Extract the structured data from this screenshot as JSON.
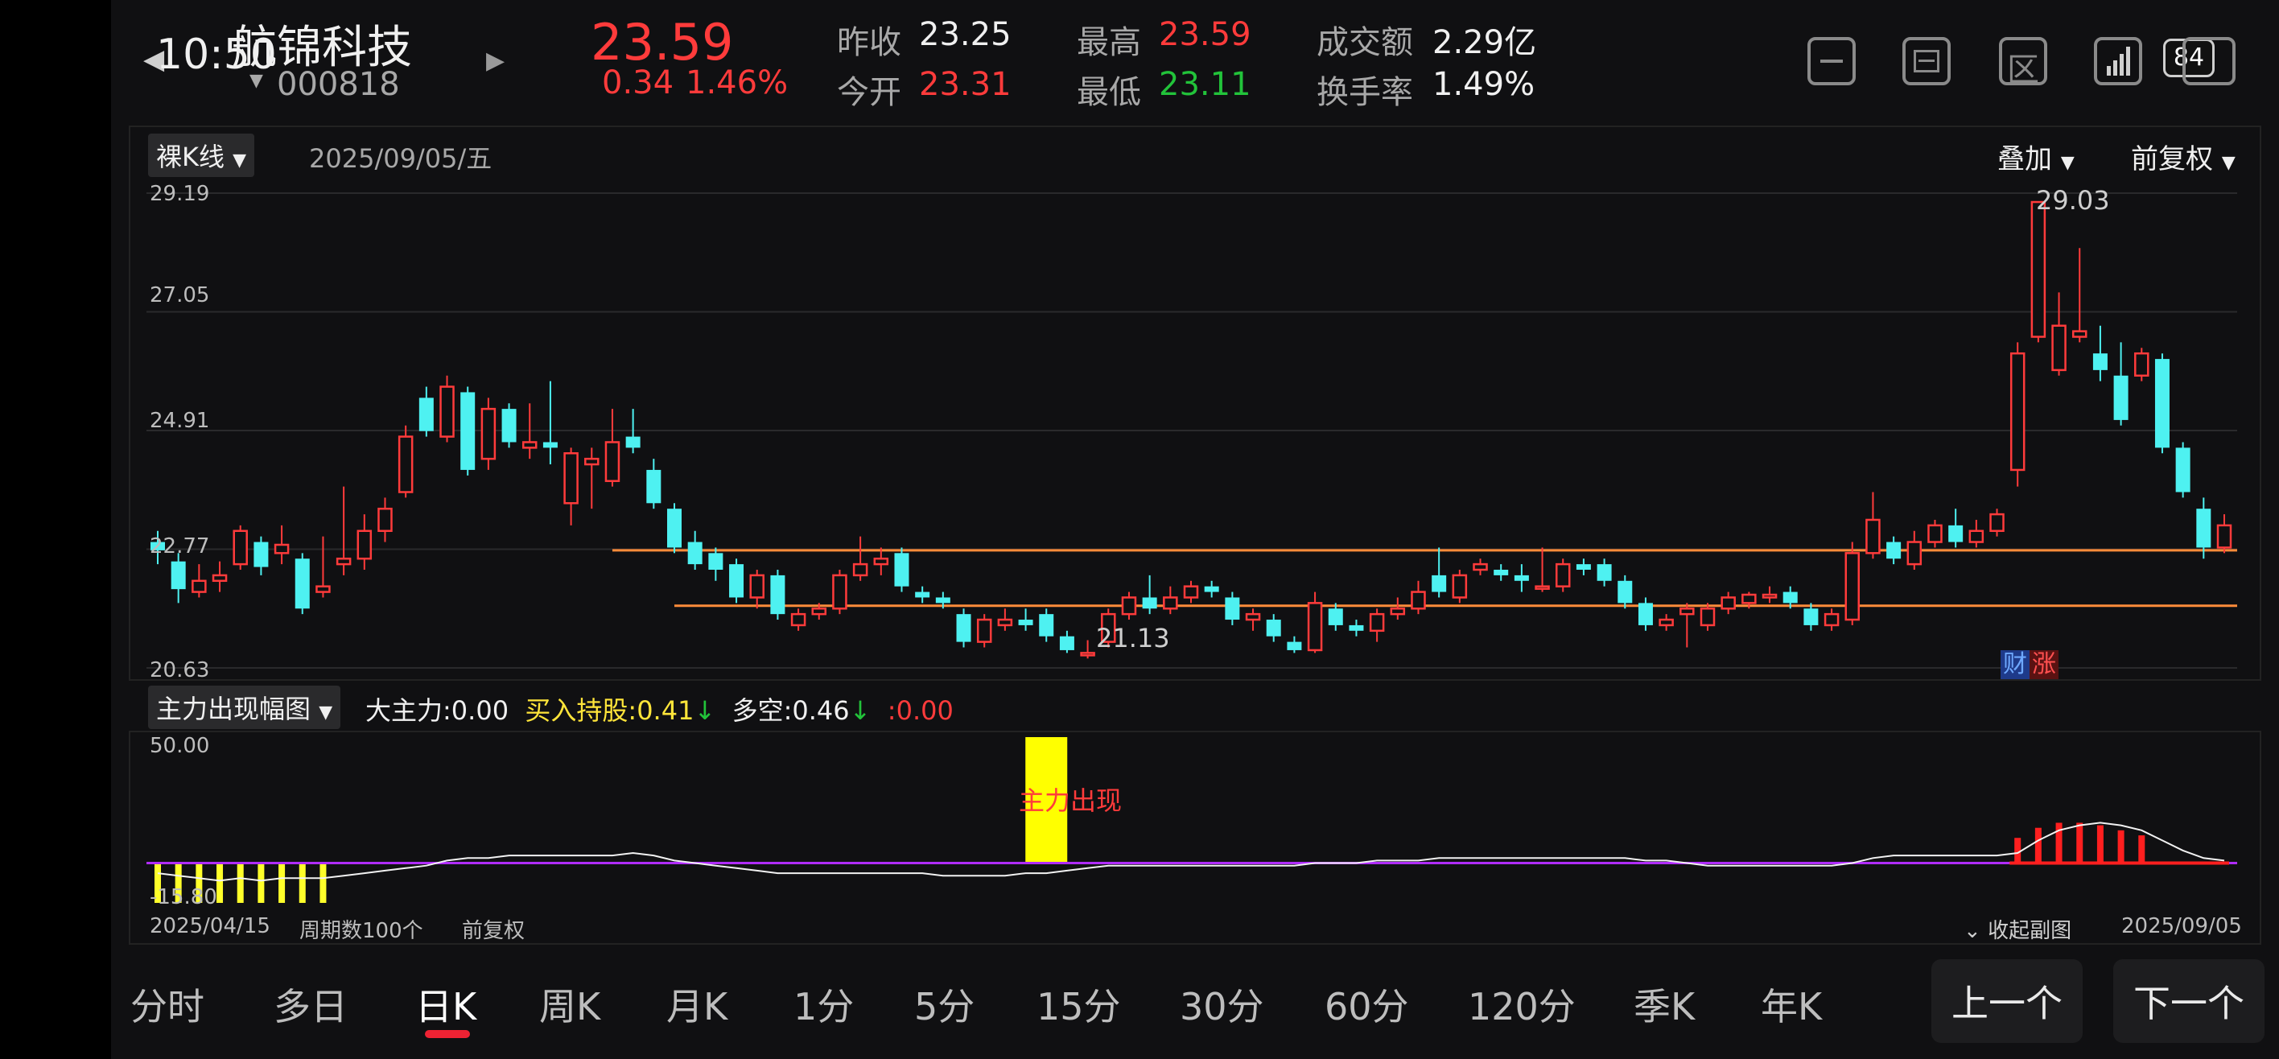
{
  "status_bar": {
    "time": "10:50",
    "battery": "84"
  },
  "stock": {
    "name": "航锦科技",
    "code": "000818",
    "price": "23.59",
    "change": "0.34",
    "change_pct": "1.46%",
    "prev_close_label": "昨收",
    "prev_close": "23.25",
    "open_label": "今开",
    "open": "23.31",
    "high_label": "最高",
    "high": "23.59",
    "low_label": "最低",
    "low": "23.11",
    "amount_label": "成交额",
    "amount": "2.29亿",
    "turnover_label": "换手率",
    "turnover": "1.49%"
  },
  "main_chart": {
    "dropdown": "裸K线",
    "date": "2025/09/05/五",
    "overlay_label": "叠加",
    "adjust_label": "前复权",
    "y_ticks": [
      "29.19",
      "27.05",
      "24.91",
      "22.77",
      "20.63"
    ],
    "high_label": "29.03",
    "low_label": "21.13",
    "badge_cai": "财",
    "badge_zhang": "涨"
  },
  "sub_chart": {
    "dropdown": "主力出现幅图",
    "legend": [
      {
        "label": "大主力",
        "value": "0.00",
        "arrow": "",
        "color": "#f0f0f0"
      },
      {
        "label": "买入持股",
        "value": "0.41",
        "arrow": "↓",
        "color": "#ffe53a"
      },
      {
        "label": "多空",
        "value": "0.46",
        "arrow": "↓",
        "color": "#f0f0f0"
      },
      {
        "label": "",
        "value": "0.00",
        "arrow": "",
        "color": "#ff3b3b"
      }
    ],
    "y_top": "50.00",
    "y_bottom": "-15.80",
    "annotation": "主力出现",
    "start_date": "2025/04/15",
    "period_count": "周期数100个",
    "adjust": "前复权",
    "collapse": "收起副图",
    "end_date": "2025/09/05"
  },
  "tabs": [
    "分时",
    "多日",
    "日K",
    "周K",
    "月K",
    "1分",
    "5分",
    "15分",
    "30分",
    "60分",
    "120分",
    "季K",
    "年K"
  ],
  "active_tab": "日K",
  "nav": {
    "prev": "上一个",
    "next": "下一个"
  },
  "chart_data": {
    "type": "candlestick",
    "y_range": [
      20.63,
      29.19
    ],
    "x_range": [
      "2025/04/15",
      "2025/09/05"
    ],
    "candles": [
      {
        "o": 22.9,
        "c": 22.75,
        "h": 23.1,
        "l": 22.5
      },
      {
        "o": 22.55,
        "c": 22.05,
        "h": 22.7,
        "l": 21.8
      },
      {
        "o": 22.0,
        "c": 22.2,
        "h": 22.5,
        "l": 21.9
      },
      {
        "o": 22.2,
        "c": 22.3,
        "h": 22.55,
        "l": 22.0
      },
      {
        "o": 22.5,
        "c": 23.1,
        "h": 23.2,
        "l": 22.4
      },
      {
        "o": 22.9,
        "c": 22.45,
        "h": 23.0,
        "l": 22.3
      },
      {
        "o": 22.7,
        "c": 22.85,
        "h": 23.2,
        "l": 22.5
      },
      {
        "o": 22.6,
        "c": 21.7,
        "h": 22.7,
        "l": 21.6
      },
      {
        "o": 22.0,
        "c": 22.1,
        "h": 23.0,
        "l": 21.9
      },
      {
        "o": 22.5,
        "c": 22.6,
        "h": 23.9,
        "l": 22.3
      },
      {
        "o": 22.6,
        "c": 23.1,
        "h": 23.4,
        "l": 22.4
      },
      {
        "o": 23.1,
        "c": 23.5,
        "h": 23.7,
        "l": 22.9
      },
      {
        "o": 23.8,
        "c": 24.8,
        "h": 25.0,
        "l": 23.7
      },
      {
        "o": 25.5,
        "c": 24.9,
        "h": 25.7,
        "l": 24.8
      },
      {
        "o": 24.8,
        "c": 25.7,
        "h": 25.9,
        "l": 24.7
      },
      {
        "o": 25.6,
        "c": 24.2,
        "h": 25.7,
        "l": 24.1
      },
      {
        "o": 24.4,
        "c": 25.3,
        "h": 25.5,
        "l": 24.2
      },
      {
        "o": 25.3,
        "c": 24.7,
        "h": 25.4,
        "l": 24.6
      },
      {
        "o": 24.6,
        "c": 24.7,
        "h": 25.4,
        "l": 24.4
      },
      {
        "o": 24.7,
        "c": 24.6,
        "h": 25.8,
        "l": 24.3
      },
      {
        "o": 23.6,
        "c": 24.5,
        "h": 24.6,
        "l": 23.2
      },
      {
        "o": 24.3,
        "c": 24.4,
        "h": 24.6,
        "l": 23.5
      },
      {
        "o": 24.0,
        "c": 24.7,
        "h": 25.3,
        "l": 23.9
      },
      {
        "o": 24.8,
        "c": 24.6,
        "h": 25.3,
        "l": 24.5
      },
      {
        "o": 24.2,
        "c": 23.6,
        "h": 24.4,
        "l": 23.5
      },
      {
        "o": 23.5,
        "c": 22.8,
        "h": 23.6,
        "l": 22.7
      },
      {
        "o": 22.9,
        "c": 22.5,
        "h": 23.1,
        "l": 22.4
      },
      {
        "o": 22.7,
        "c": 22.4,
        "h": 22.8,
        "l": 22.2
      },
      {
        "o": 22.5,
        "c": 21.9,
        "h": 22.6,
        "l": 21.8
      },
      {
        "o": 21.9,
        "c": 22.3,
        "h": 22.4,
        "l": 21.7
      },
      {
        "o": 22.3,
        "c": 21.6,
        "h": 22.4,
        "l": 21.5
      },
      {
        "o": 21.4,
        "c": 21.6,
        "h": 21.7,
        "l": 21.3
      },
      {
        "o": 21.6,
        "c": 21.7,
        "h": 21.8,
        "l": 21.5
      },
      {
        "o": 21.7,
        "c": 22.3,
        "h": 22.4,
        "l": 21.6
      },
      {
        "o": 22.3,
        "c": 22.5,
        "h": 23.0,
        "l": 22.2
      },
      {
        "o": 22.5,
        "c": 22.6,
        "h": 22.8,
        "l": 22.3
      },
      {
        "o": 22.7,
        "c": 22.1,
        "h": 22.8,
        "l": 22.0
      },
      {
        "o": 22.0,
        "c": 21.9,
        "h": 22.1,
        "l": 21.8
      },
      {
        "o": 21.9,
        "c": 21.8,
        "h": 22.0,
        "l": 21.7
      },
      {
        "o": 21.6,
        "c": 21.1,
        "h": 21.7,
        "l": 21.0
      },
      {
        "o": 21.1,
        "c": 21.5,
        "h": 21.6,
        "l": 21.0
      },
      {
        "o": 21.4,
        "c": 21.5,
        "h": 21.7,
        "l": 21.3
      },
      {
        "o": 21.5,
        "c": 21.4,
        "h": 21.7,
        "l": 21.3
      },
      {
        "o": 21.6,
        "c": 21.2,
        "h": 21.7,
        "l": 21.1
      },
      {
        "o": 21.2,
        "c": 20.95,
        "h": 21.3,
        "l": 20.9
      },
      {
        "o": 20.9,
        "c": 20.9,
        "h": 21.13,
        "l": 20.8
      },
      {
        "o": 21.1,
        "c": 21.6,
        "h": 21.7,
        "l": 21.0
      },
      {
        "o": 21.6,
        "c": 21.9,
        "h": 22.0,
        "l": 21.5
      },
      {
        "o": 21.9,
        "c": 21.7,
        "h": 22.3,
        "l": 21.6
      },
      {
        "o": 21.7,
        "c": 21.9,
        "h": 22.1,
        "l": 21.6
      },
      {
        "o": 21.9,
        "c": 22.1,
        "h": 22.2,
        "l": 21.8
      },
      {
        "o": 22.1,
        "c": 22.0,
        "h": 22.2,
        "l": 21.9
      },
      {
        "o": 21.9,
        "c": 21.5,
        "h": 22.0,
        "l": 21.4
      },
      {
        "o": 21.5,
        "c": 21.6,
        "h": 21.7,
        "l": 21.3
      },
      {
        "o": 21.5,
        "c": 21.2,
        "h": 21.6,
        "l": 21.1
      },
      {
        "o": 21.1,
        "c": 20.95,
        "h": 21.2,
        "l": 20.9
      },
      {
        "o": 20.95,
        "c": 21.8,
        "h": 22.0,
        "l": 20.9
      },
      {
        "o": 21.7,
        "c": 21.4,
        "h": 21.8,
        "l": 21.3
      },
      {
        "o": 21.4,
        "c": 21.3,
        "h": 21.5,
        "l": 21.2
      },
      {
        "o": 21.3,
        "c": 21.6,
        "h": 21.7,
        "l": 21.1
      },
      {
        "o": 21.6,
        "c": 21.7,
        "h": 21.9,
        "l": 21.5
      },
      {
        "o": 21.7,
        "c": 22.0,
        "h": 22.2,
        "l": 21.6
      },
      {
        "o": 22.3,
        "c": 22.0,
        "h": 22.8,
        "l": 21.9
      },
      {
        "o": 21.9,
        "c": 22.3,
        "h": 22.4,
        "l": 21.8
      },
      {
        "o": 22.4,
        "c": 22.5,
        "h": 22.6,
        "l": 22.3
      },
      {
        "o": 22.4,
        "c": 22.3,
        "h": 22.5,
        "l": 22.2
      },
      {
        "o": 22.3,
        "c": 22.2,
        "h": 22.5,
        "l": 22.0
      },
      {
        "o": 22.1,
        "c": 22.1,
        "h": 22.8,
        "l": 22.0
      },
      {
        "o": 22.1,
        "c": 22.5,
        "h": 22.6,
        "l": 22.0
      },
      {
        "o": 22.5,
        "c": 22.4,
        "h": 22.6,
        "l": 22.3
      },
      {
        "o": 22.5,
        "c": 22.2,
        "h": 22.6,
        "l": 22.1
      },
      {
        "o": 22.2,
        "c": 21.8,
        "h": 22.3,
        "l": 21.7
      },
      {
        "o": 21.8,
        "c": 21.4,
        "h": 21.9,
        "l": 21.3
      },
      {
        "o": 21.4,
        "c": 21.5,
        "h": 21.6,
        "l": 21.3
      },
      {
        "o": 21.6,
        "c": 21.7,
        "h": 21.8,
        "l": 21.0
      },
      {
        "o": 21.4,
        "c": 21.7,
        "h": 21.8,
        "l": 21.3
      },
      {
        "o": 21.7,
        "c": 21.9,
        "h": 22.0,
        "l": 21.6
      },
      {
        "o": 21.8,
        "c": 21.95,
        "h": 22.0,
        "l": 21.7
      },
      {
        "o": 21.9,
        "c": 21.95,
        "h": 22.1,
        "l": 21.8
      },
      {
        "o": 22.0,
        "c": 21.8,
        "h": 22.1,
        "l": 21.7
      },
      {
        "o": 21.7,
        "c": 21.4,
        "h": 21.8,
        "l": 21.3
      },
      {
        "o": 21.4,
        "c": 21.6,
        "h": 21.7,
        "l": 21.3
      },
      {
        "o": 21.5,
        "c": 22.7,
        "h": 22.9,
        "l": 21.4
      },
      {
        "o": 22.7,
        "c": 23.3,
        "h": 23.8,
        "l": 22.6
      },
      {
        "o": 22.9,
        "c": 22.6,
        "h": 23.0,
        "l": 22.5
      },
      {
        "o": 22.5,
        "c": 22.9,
        "h": 23.1,
        "l": 22.4
      },
      {
        "o": 22.9,
        "c": 23.2,
        "h": 23.3,
        "l": 22.8
      },
      {
        "o": 23.2,
        "c": 22.9,
        "h": 23.5,
        "l": 22.8
      },
      {
        "o": 22.9,
        "c": 23.1,
        "h": 23.3,
        "l": 22.8
      },
      {
        "o": 23.1,
        "c": 23.4,
        "h": 23.5,
        "l": 23.0
      },
      {
        "o": 24.2,
        "c": 26.3,
        "h": 26.5,
        "l": 23.9
      },
      {
        "o": 26.6,
        "c": 29.03,
        "h": 29.03,
        "l": 26.5
      },
      {
        "o": 26.0,
        "c": 26.8,
        "h": 27.4,
        "l": 25.9
      },
      {
        "o": 26.6,
        "c": 26.7,
        "h": 28.2,
        "l": 26.5
      },
      {
        "o": 26.3,
        "c": 26.0,
        "h": 26.8,
        "l": 25.8
      },
      {
        "o": 25.9,
        "c": 25.1,
        "h": 26.5,
        "l": 25.0
      },
      {
        "o": 25.9,
        "c": 26.3,
        "h": 26.4,
        "l": 25.8
      },
      {
        "o": 26.2,
        "c": 24.6,
        "h": 26.3,
        "l": 24.5
      },
      {
        "o": 24.6,
        "c": 23.8,
        "h": 24.7,
        "l": 23.7
      },
      {
        "o": 23.5,
        "c": 22.8,
        "h": 23.7,
        "l": 22.6
      },
      {
        "o": 22.8,
        "c": 23.2,
        "h": 23.4,
        "l": 22.7
      }
    ],
    "support_lines": [
      {
        "value": 22.75,
        "start_index": 22
      },
      {
        "value": 21.75,
        "start_index": 25
      }
    ],
    "sub_indicator": {
      "y_range": [
        -15.8,
        50.0
      ],
      "white_line": [
        -4,
        -5,
        -6,
        -7,
        -6,
        -7,
        -6,
        -6,
        -6,
        -5,
        -4,
        -3,
        -2,
        -1,
        1,
        2,
        2,
        3,
        3,
        3,
        3,
        3,
        3,
        4,
        3,
        1,
        0,
        -1,
        -2,
        -3,
        -4,
        -4,
        -4,
        -4,
        -4,
        -4,
        -4,
        -4,
        -5,
        -5,
        -5,
        -5,
        -4,
        -4,
        -3,
        -2,
        -1,
        -1,
        -1,
        -1,
        -1,
        -1,
        -1,
        -1,
        -1,
        -1,
        0,
        0,
        0,
        1,
        1,
        1,
        2,
        2,
        2,
        2,
        2,
        2,
        2,
        2,
        2,
        2,
        1,
        1,
        0,
        -1,
        -1,
        -1,
        -1,
        -1,
        -1,
        -1,
        0,
        2,
        3,
        3,
        3,
        3,
        3,
        3,
        4,
        9,
        13,
        15,
        16,
        15,
        13,
        9,
        5,
        2,
        1
      ],
      "yellow_bars_index_range": [
        0,
        8
      ],
      "yellow_bars_value": -15.8,
      "annotation_bar_index": 43,
      "annotation_bar_value": 50.0,
      "red_bars": [
        {
          "i": 90,
          "v": 10
        },
        {
          "i": 91,
          "v": 14
        },
        {
          "i": 92,
          "v": 16
        },
        {
          "i": 93,
          "v": 16
        },
        {
          "i": 94,
          "v": 15
        },
        {
          "i": 95,
          "v": 13
        },
        {
          "i": 96,
          "v": 11
        }
      ]
    }
  }
}
